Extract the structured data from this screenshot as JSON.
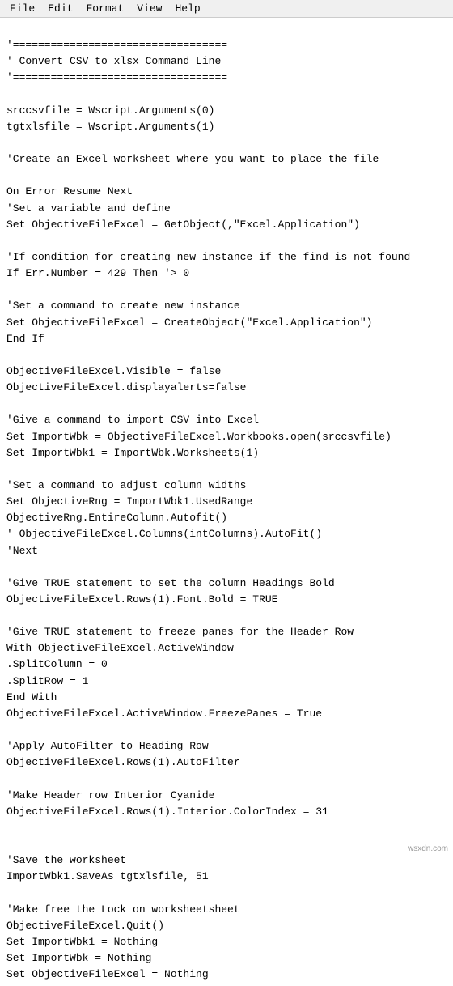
{
  "menu": {
    "items": [
      "File",
      "Edit",
      "Format",
      "View",
      "Help"
    ]
  },
  "watermark": "wsxdn.com",
  "code": {
    "lines": [
      "'==================================",
      "' Convert CSV to xlsx Command Line",
      "'==================================",
      "",
      "srccsvfile = Wscript.Arguments(0)",
      "tgtxlsfile = Wscript.Arguments(1)",
      "",
      "'Create an Excel worksheet where you want to place the file",
      "",
      "On Error Resume Next",
      "'Set a variable and define",
      "Set ObjectiveFileExcel = GetObject(,\"Excel.Application\")",
      "",
      "'If condition for creating new instance if the find is not found",
      "If Err.Number = 429 Then '> 0",
      "",
      "'Set a command to create new instance",
      "Set ObjectiveFileExcel = CreateObject(\"Excel.Application\")",
      "End If",
      "",
      "ObjectiveFileExcel.Visible = false",
      "ObjectiveFileExcel.displayalerts=false",
      "",
      "'Give a command to import CSV into Excel",
      "Set ImportWbk = ObjectiveFileExcel.Workbooks.open(srccsvfile)",
      "Set ImportWbk1 = ImportWbk.Worksheets(1)",
      "",
      "'Set a command to adjust column widths",
      "Set ObjectiveRng = ImportWbk1.UsedRange",
      "ObjectiveRng.EntireColumn.Autofit()",
      "' ObjectiveFileExcel.Columns(intColumns).AutoFit()",
      "'Next",
      "",
      "'Give TRUE statement to set the column Headings Bold",
      "ObjectiveFileExcel.Rows(1).Font.Bold = TRUE",
      "",
      "'Give TRUE statement to freeze panes for the Header Row",
      "With ObjectiveFileExcel.ActiveWindow",
      ".SplitColumn = 0",
      ".SplitRow = 1",
      "End With",
      "ObjectiveFileExcel.ActiveWindow.FreezePanes = True",
      "",
      "'Apply AutoFilter to Heading Row",
      "ObjectiveFileExcel.Rows(1).AutoFilter",
      "",
      "'Make Header row Interior Cyanide",
      "ObjectiveFileExcel.Rows(1).Interior.ColorIndex = 31",
      "",
      "",
      "'Save the worksheet",
      "ImportWbk1.SaveAs tgtxlsfile, 51",
      "",
      "'Make free the Lock on worksheetsheet",
      "ObjectiveFileExcel.Quit()",
      "Set ImportWbk1 = Nothing",
      "Set ImportWbk = Nothing",
      "Set ObjectiveFileExcel = Nothing"
    ]
  }
}
